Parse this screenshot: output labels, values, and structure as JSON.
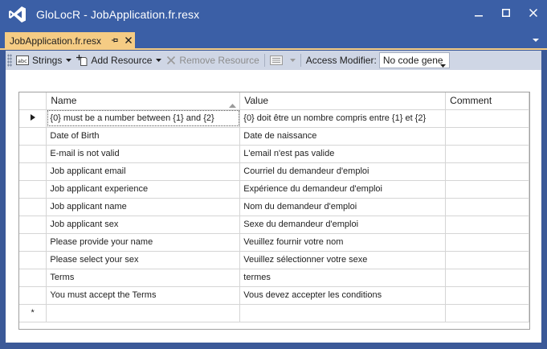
{
  "window": {
    "title": "GloLocR - JobApplication.fr.resx",
    "buttons": {
      "minimize": "minimize",
      "maximize": "maximize",
      "close": "close"
    }
  },
  "tab": {
    "label": "JobApplication.fr.resx"
  },
  "toolbar": {
    "strings_label": "Strings",
    "add_resource_label": "Add Resource",
    "remove_resource_label": "Remove Resource",
    "access_modifier_label": "Access Modifier:",
    "access_modifier_value": "No code gene"
  },
  "grid": {
    "columns": [
      "Name",
      "Value",
      "Comment"
    ],
    "rows": [
      {
        "name": "{0} must be a number between {1} and {2}",
        "value": "{0} doit être un nombre compris entre {1} et {2}",
        "comment": ""
      },
      {
        "name": "Date of Birth",
        "value": "Date de naissance",
        "comment": ""
      },
      {
        "name": "E-mail is not valid",
        "value": "L'email n'est pas valide",
        "comment": ""
      },
      {
        "name": "Job applicant email",
        "value": "Courriel du demandeur d'emploi",
        "comment": ""
      },
      {
        "name": "Job applicant experience",
        "value": "Expérience du demandeur d'emploi",
        "comment": ""
      },
      {
        "name": "Job applicant name",
        "value": "Nom du demandeur d'emploi",
        "comment": ""
      },
      {
        "name": "Job applicant sex",
        "value": "Sexe du demandeur d'emploi",
        "comment": ""
      },
      {
        "name": "Please provide your name",
        "value": "Veuillez fournir votre nom",
        "comment": ""
      },
      {
        "name": "Please select your sex",
        "value": "Veuillez sélectionner votre sexe",
        "comment": ""
      },
      {
        "name": "Terms",
        "value": "termes",
        "comment": ""
      },
      {
        "name": "You must accept the Terms",
        "value": "Vous devez accepter les conditions",
        "comment": ""
      }
    ],
    "new_row_marker": "*"
  },
  "colors": {
    "titlebar": "#3b5fa6",
    "tab_active": "#f5cc84",
    "toolbar": "#cfd6e5",
    "grid_line": "#d5d5d5"
  },
  "icons": {
    "app": "visual-studio-icon",
    "strings": "abc-string-icon",
    "add": "add-resource-icon",
    "remove": "remove-x-icon",
    "views": "views-icon",
    "current_row": "row-pointer-icon"
  }
}
